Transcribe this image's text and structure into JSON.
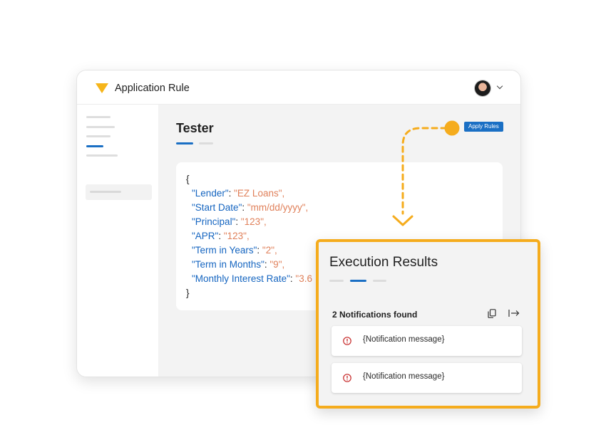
{
  "app": {
    "title": "Application Rule",
    "logo_color": "#f6b51a"
  },
  "header": {
    "avatar_icon": "user-avatar",
    "menu_icon": "chevron-down-icon"
  },
  "tester": {
    "title": "Tester",
    "apply_button_label": "Apply Rules",
    "json": {
      "open_brace": "{",
      "close_brace": "}",
      "fields": [
        {
          "key": "\"Lender\"",
          "value": "\"EZ Loans\","
        },
        {
          "key": "\"Start Date\"",
          "value": "\"mm/dd/yyyy\","
        },
        {
          "key": "\"Principal\"",
          "value": "\"123\","
        },
        {
          "key": "\"APR\"",
          "value": "\"123\","
        },
        {
          "key": "\"Term in Years\"",
          "value": "\"2\","
        },
        {
          "key": "\"Term in Months\"",
          "value": "\"9\","
        },
        {
          "key": "\"Monthly Interest Rate\"",
          "value": "\"3.6"
        }
      ]
    }
  },
  "results": {
    "title": "Execution Results",
    "count_label": "2 Notifications found",
    "notifications": [
      {
        "message": "{Notification message}"
      },
      {
        "message": "{Notification message}"
      }
    ]
  },
  "colors": {
    "accent_blue": "#1a6fc4",
    "highlight_orange": "#f5ac1d",
    "error_red": "#c62828"
  }
}
